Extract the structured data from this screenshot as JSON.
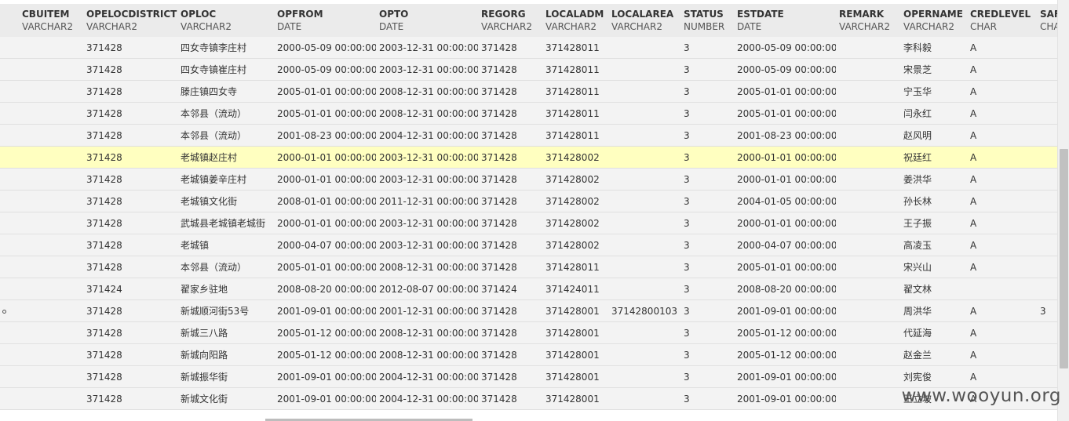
{
  "columns": [
    {
      "name": "CBUITEM",
      "type": "VARCHAR2"
    },
    {
      "name": "OPELOCDISTRICT",
      "type": "VARCHAR2"
    },
    {
      "name": "OPLOC",
      "type": "VARCHAR2"
    },
    {
      "name": "OPFROM",
      "type": "DATE"
    },
    {
      "name": "OPTO",
      "type": "DATE"
    },
    {
      "name": "REGORG",
      "type": "VARCHAR2"
    },
    {
      "name": "LOCALADM",
      "type": "VARCHAR2"
    },
    {
      "name": "LOCALAREA",
      "type": "VARCHAR2"
    },
    {
      "name": "STATUS",
      "type": "NUMBER"
    },
    {
      "name": "ESTDATE",
      "type": "DATE"
    },
    {
      "name": "REMARK",
      "type": "VARCHAR2"
    },
    {
      "name": "OPERNAME",
      "type": "VARCHAR2"
    },
    {
      "name": "CREDLEVEL",
      "type": "CHAR"
    },
    {
      "name": "SAF",
      "type": "CHA"
    }
  ],
  "rows": [
    [
      "",
      "371428",
      "四女寺镇李庄村",
      "2000-05-09 00:00:00",
      "2003-12-31 00:00:00",
      "371428",
      "371428011",
      "",
      "3",
      "2000-05-09 00:00:00",
      "",
      "李科毅",
      "A",
      ""
    ],
    [
      "",
      "371428",
      "四女寺镇崔庄村",
      "2000-05-09 00:00:00",
      "2003-12-31 00:00:00",
      "371428",
      "371428011",
      "",
      "3",
      "2000-05-09 00:00:00",
      "",
      "宋景芝",
      "A",
      ""
    ],
    [
      "",
      "371428",
      "滕庄镇四女寺",
      "2005-01-01 00:00:00",
      "2008-12-31 00:00:00",
      "371428",
      "371428011",
      "",
      "3",
      "2005-01-01 00:00:00",
      "",
      "宁玉华",
      "A",
      ""
    ],
    [
      "",
      "371428",
      "本邻县（流动）",
      "2005-01-01 00:00:00",
      "2008-12-31 00:00:00",
      "371428",
      "371428011",
      "",
      "3",
      "2005-01-01 00:00:00",
      "",
      "闫永红",
      "A",
      ""
    ],
    [
      "",
      "371428",
      "本邻县（流动）",
      "2001-08-23 00:00:00",
      "2004-12-31 00:00:00",
      "371428",
      "371428011",
      "",
      "3",
      "2001-08-23 00:00:00",
      "",
      "赵风明",
      "A",
      ""
    ],
    [
      "",
      "371428",
      "老城镇赵庄村",
      "2000-01-01 00:00:00",
      "2003-12-31 00:00:00",
      "371428",
      "371428002",
      "",
      "3",
      "2000-01-01 00:00:00",
      "",
      "祝廷红",
      "A",
      ""
    ],
    [
      "",
      "371428",
      "老城镇姜辛庄村",
      "2000-01-01 00:00:00",
      "2003-12-31 00:00:00",
      "371428",
      "371428002",
      "",
      "3",
      "2000-01-01 00:00:00",
      "",
      "姜洪华",
      "A",
      ""
    ],
    [
      "",
      "371428",
      "老城镇文化街",
      "2008-01-01 00:00:00",
      "2011-12-31 00:00:00",
      "371428",
      "371428002",
      "",
      "3",
      "2004-01-05 00:00:00",
      "",
      "孙长林",
      "A",
      ""
    ],
    [
      "",
      "371428",
      "武城县老城镇老城街",
      "2000-01-01 00:00:00",
      "2003-12-31 00:00:00",
      "371428",
      "371428002",
      "",
      "3",
      "2000-01-01 00:00:00",
      "",
      "王子振",
      "A",
      ""
    ],
    [
      "",
      "371428",
      "老城镇",
      "2000-04-07 00:00:00",
      "2003-12-31 00:00:00",
      "371428",
      "371428002",
      "",
      "3",
      "2000-04-07 00:00:00",
      "",
      "高凌玉",
      "A",
      ""
    ],
    [
      "",
      "371428",
      "本邻县（流动）",
      "2005-01-01 00:00:00",
      "2008-12-31 00:00:00",
      "371428",
      "371428011",
      "",
      "3",
      "2005-01-01 00:00:00",
      "",
      "宋兴山",
      "A",
      ""
    ],
    [
      "",
      "371424",
      "翟家乡驻地",
      "2008-08-20 00:00:00",
      "2012-08-07 00:00:00",
      "371424",
      "371424011",
      "",
      "3",
      "2008-08-20 00:00:00",
      "",
      "翟文林",
      "",
      ""
    ],
    [
      "",
      "371428",
      "新城顺河街53号",
      "2001-09-01 00:00:00",
      "2001-12-31 00:00:00",
      "371428",
      "371428001",
      "37142800103",
      "3",
      "2001-09-01 00:00:00",
      "",
      "周洪华",
      "A",
      "3"
    ],
    [
      "",
      "371428",
      "新城三八路",
      "2005-01-12 00:00:00",
      "2008-12-31 00:00:00",
      "371428",
      "371428001",
      "",
      "3",
      "2005-01-12 00:00:00",
      "",
      "代延海",
      "A",
      ""
    ],
    [
      "",
      "371428",
      "新城向阳路",
      "2005-01-12 00:00:00",
      "2008-12-31 00:00:00",
      "371428",
      "371428001",
      "",
      "3",
      "2005-01-12 00:00:00",
      "",
      "赵金兰",
      "A",
      ""
    ],
    [
      "",
      "371428",
      "新城振华街",
      "2001-09-01 00:00:00",
      "2004-12-31 00:00:00",
      "371428",
      "371428001",
      "",
      "3",
      "2001-09-01 00:00:00",
      "",
      "刘宪俊",
      "A",
      ""
    ],
    [
      "",
      "371428",
      "新城文化街",
      "2001-09-01 00:00:00",
      "2004-12-31 00:00:00",
      "371428",
      "371428001",
      "",
      "3",
      "2001-09-01 00:00:00",
      "",
      "王立坡",
      "A",
      ""
    ]
  ],
  "selected_row_index": 5,
  "colors": {
    "header_bg": "#ebebeb",
    "row_bg": "#f3f3f3",
    "selected_row_bg": "#ffffc0",
    "scrollbar_thumb": "#c1c1c1"
  },
  "watermark": "www.wooyun.org"
}
